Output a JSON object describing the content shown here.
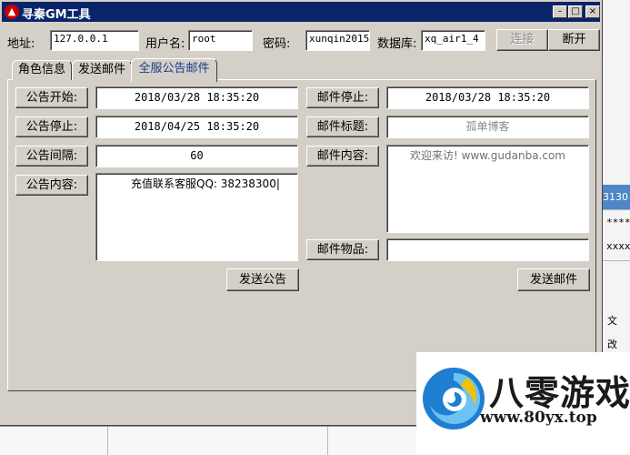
{
  "window": {
    "title": "寻秦GM工具"
  },
  "connection": {
    "address_label": "地址:",
    "address_value": "127.0.0.1",
    "user_label": "用户名:",
    "user_value": "root",
    "password_label": "密码:",
    "password_value": "xunqin2015",
    "database_label": "数据库:",
    "database_value": "xq_air1_4",
    "connect_label": "连接",
    "disconnect_label": "断开"
  },
  "tabs": [
    {
      "label": "角色信息",
      "active": false
    },
    {
      "label": "发送邮件",
      "active": false
    },
    {
      "label": "全服公告邮件",
      "active": true
    }
  ],
  "announcement": {
    "start_label": "公告开始:",
    "start_value": "2018/03/28 18:35:20",
    "stop_label": "公告停止:",
    "stop_value": "2018/04/25 18:35:20",
    "interval_label": "公告间隔:",
    "interval_value": "60",
    "content_label": "公告内容:",
    "content_value": "充值联系客服QQ: 38238300",
    "send_label": "发送公告"
  },
  "mail": {
    "stop_label": "邮件停止:",
    "stop_value": "2018/03/28 18:35:20",
    "title_label": "邮件标题:",
    "title_value": "孤单博客",
    "content_label": "邮件内容:",
    "content_value": "欢迎来访! www.gudanba.com",
    "items_label": "邮件物品:",
    "items_value": "",
    "send_label": "发送邮件"
  },
  "background": {
    "blue_cell": "3130",
    "cell_stars": "****",
    "cell_x": "xxxx",
    "cell_char": "文",
    "cell_char2": "改"
  },
  "watermark": {
    "name": "八零游戏",
    "url": "www.80yx.top"
  },
  "colors": {
    "titlebar": "#0a246a",
    "window_face": "#d4d0c8",
    "active_tab_text": "#1f3b8c",
    "logo_blue": "#1e7fd0"
  }
}
